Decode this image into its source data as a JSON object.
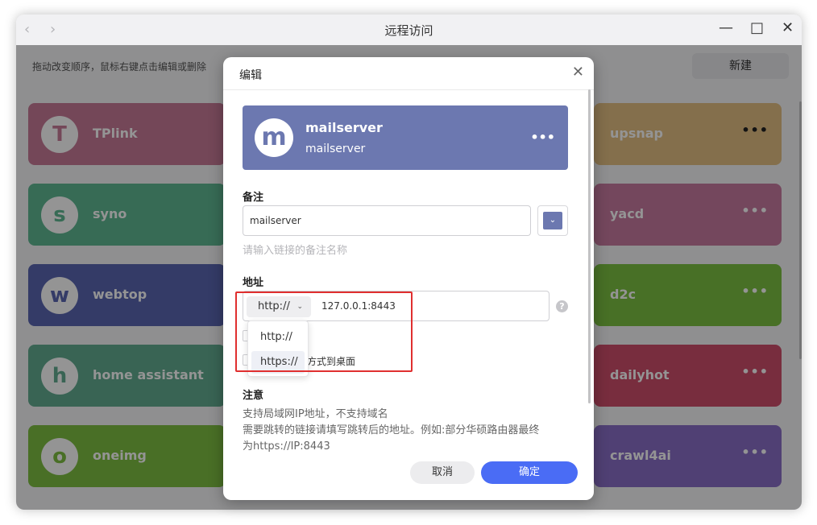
{
  "window": {
    "title": "远程访问",
    "nav_back": "‹",
    "nav_forward": "›",
    "minimize": "—",
    "maximize": "□",
    "close": "✕"
  },
  "toolbar": {
    "hint": "拖动改变顺序，鼠标右键点击编辑或删除",
    "new_label": "新建"
  },
  "cards_left": [
    {
      "letter": "T",
      "name": "TPlink",
      "color": "#c87a98"
    },
    {
      "letter": "s",
      "name": "syno",
      "color": "#5fb893"
    },
    {
      "letter": "w",
      "name": "webtop",
      "color": "#5a67b2"
    },
    {
      "letter": "h",
      "name": "home assistant",
      "color": "#62ad91"
    },
    {
      "letter": "o",
      "name": "oneimg",
      "color": "#7fbf43"
    }
  ],
  "cards_right": [
    {
      "name": "upsnap",
      "color": "#e3bf84",
      "dots": "•••"
    },
    {
      "name": "yacd",
      "color": "#c87aa0",
      "dots": "•••"
    },
    {
      "name": "d2c",
      "color": "#7cc143",
      "dots": "•••"
    },
    {
      "name": "dailyhot",
      "color": "#cf4e6c",
      "dots": "•••"
    },
    {
      "name": "crawl4ai",
      "color": "#8a6fc8",
      "dots": "•••"
    }
  ],
  "dialog": {
    "title": "编辑",
    "close": "✕",
    "preview": {
      "letter": "m",
      "name": "mailserver",
      "address": "mailserver",
      "dots": "•••",
      "color": "#6c78b0"
    },
    "remark_label": "备注",
    "remark_value": "mailserver",
    "remark_help": "请输入链接的备注名称",
    "address_label": "地址",
    "protocol_selected": "http://",
    "address_value": "127.0.0.1:8443",
    "help_icon": "?",
    "protocol_options": [
      "http://",
      "https://"
    ],
    "checkbox_desktop_label": "方式到桌面",
    "note_label": "注意",
    "note_lines": [
      "支持局域网IP地址，不支持域名",
      "需要跳转的链接请填写跳转后的地址。例如:部分华硕路由器最终",
      "为https://IP:8443"
    ],
    "cancel_label": "取消",
    "ok_label": "确定"
  }
}
